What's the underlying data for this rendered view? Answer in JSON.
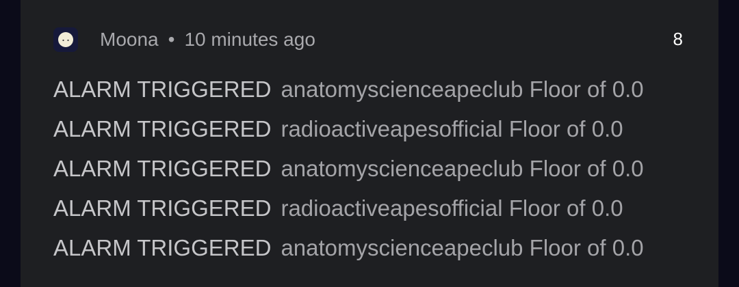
{
  "notification": {
    "app_name": "Moona",
    "separator": "•",
    "time": "10 minutes ago",
    "count": "8",
    "icon": "moon-face-icon",
    "lines": [
      {
        "title": "ALARM TRIGGERED",
        "body": "anatomyscienceapeclub Floor of 0.0"
      },
      {
        "title": "ALARM TRIGGERED",
        "body": "radioactiveapesofficial Floor of 0.0"
      },
      {
        "title": "ALARM TRIGGERED",
        "body": "anatomyscienceapeclub Floor of 0.0"
      },
      {
        "title": "ALARM TRIGGERED",
        "body": "radioactiveapesofficial Floor of 0.0"
      },
      {
        "title": "ALARM TRIGGERED",
        "body": "anatomyscienceapeclub Floor of 0.0"
      }
    ]
  },
  "colors": {
    "page_bg": "#0b0b19",
    "card_bg": "#1e1f22",
    "count_text": "#ffffff"
  }
}
